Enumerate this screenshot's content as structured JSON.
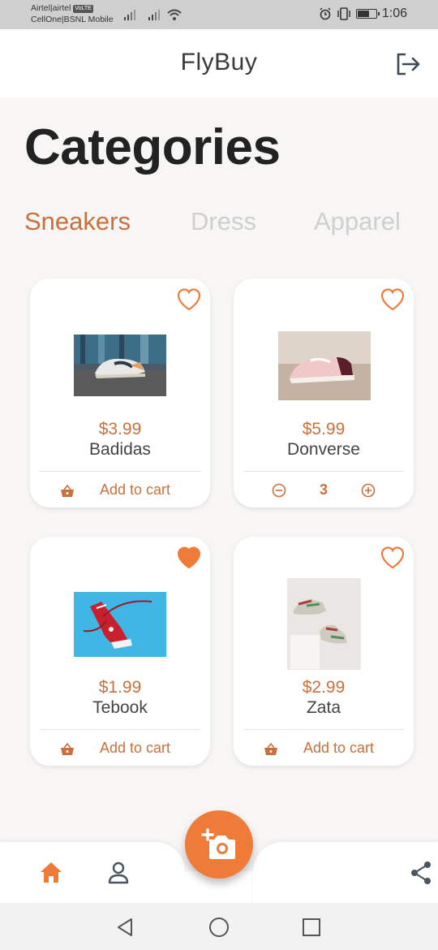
{
  "status_bar": {
    "carrier_line1": "Airtel|airtel",
    "volte_badge": "VoLTE",
    "carrier_line2": "CellOne|BSNL Mobile",
    "time": "1:06",
    "battery_level": 0.6
  },
  "app_bar": {
    "title": "FlyBuy",
    "logout_icon": "logout-icon"
  },
  "page": {
    "heading": "Categories"
  },
  "tabs": [
    {
      "label": "Sneakers",
      "active": true
    },
    {
      "label": "Dress",
      "active": false
    },
    {
      "label": "Apparel",
      "active": false
    }
  ],
  "products": [
    {
      "price": "$3.99",
      "name": "Badidas",
      "favorite": false,
      "action": "add",
      "action_label": "Add to cart"
    },
    {
      "price": "$5.99",
      "name": "Donverse",
      "favorite": false,
      "action": "quantity",
      "quantity": "3"
    },
    {
      "price": "$1.99",
      "name": "Tebook",
      "favorite": true,
      "action": "add",
      "action_label": "Add to cart"
    },
    {
      "price": "$2.99",
      "name": "Zata",
      "favorite": false,
      "action": "add",
      "action_label": "Add to cart"
    }
  ],
  "bottom_nav": {
    "items": [
      "home-icon",
      "profile-icon",
      "share-icon"
    ],
    "fab_icon": "add-photo-icon"
  },
  "colors": {
    "accent": "#ef7b39",
    "accent_text": "#c8713c",
    "inactive_tab": "#cfcfcf",
    "heading": "#222222"
  }
}
